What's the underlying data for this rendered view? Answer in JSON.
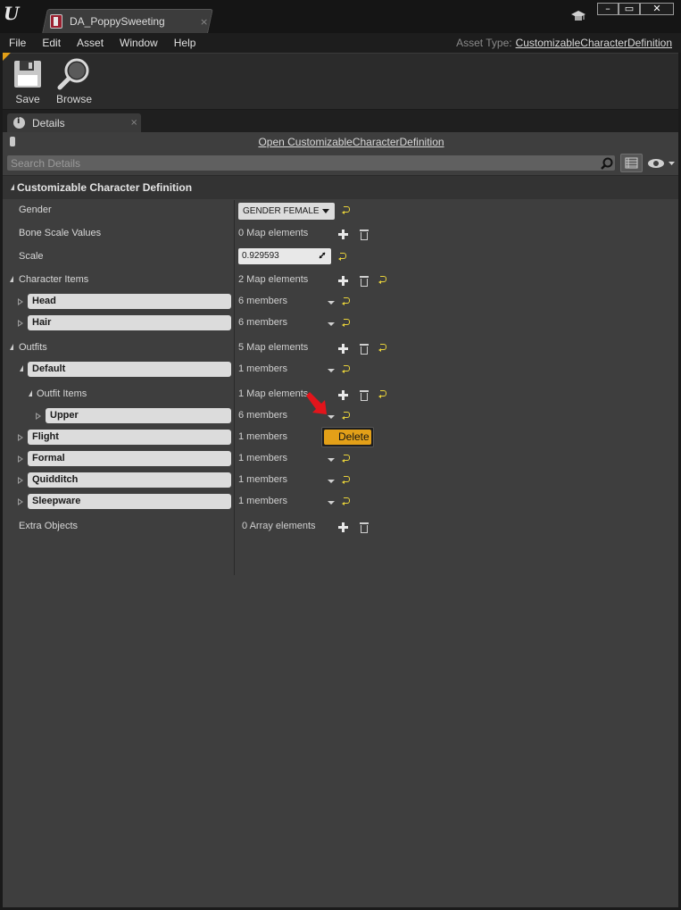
{
  "window": {
    "tab_title": "DA_PoppySweeting",
    "tab_close": "×",
    "min_glyph": "–",
    "max_glyph": "▭",
    "close_glyph": "✕"
  },
  "menu": {
    "items": [
      "File",
      "Edit",
      "Asset",
      "Window",
      "Help"
    ],
    "asset_type_label": "Asset Type:",
    "asset_type_value": "CustomizableCharacterDefinition"
  },
  "toolbar": {
    "save_label": "Save",
    "browse_label": "Browse"
  },
  "details": {
    "tab_label": "Details",
    "tab_close": "×",
    "open_link": "Open CustomizableCharacterDefinition",
    "search_placeholder": "Search Details",
    "category": "Customizable Character Definition"
  },
  "properties": {
    "gender": {
      "name": "Gender",
      "value": "GENDER FEMALE"
    },
    "bone_scale": {
      "name": "Bone Scale Values",
      "value": "0 Map elements"
    },
    "scale": {
      "name": "Scale",
      "value": "0.929593"
    },
    "character_items": {
      "name": "Character Items",
      "value": "2 Map elements"
    },
    "head": {
      "key": "Head",
      "value": "6 members"
    },
    "hair": {
      "key": "Hair",
      "value": "6 members"
    },
    "outfits": {
      "name": "Outfits",
      "value": "5 Map elements"
    },
    "default": {
      "key": "Default",
      "value": "1 members"
    },
    "outfit_items": {
      "name": "Outfit Items",
      "value": "1 Map elements"
    },
    "upper": {
      "key": "Upper",
      "value": "6 members"
    },
    "flight": {
      "key": "Flight",
      "value": "1 members"
    },
    "formal": {
      "key": "Formal",
      "value": "1 members"
    },
    "quidditch": {
      "key": "Quidditch",
      "value": "1 members"
    },
    "sleepware": {
      "key": "Sleepware",
      "value": "1 members"
    },
    "extra_objects": {
      "name": "Extra Objects",
      "value": "0 Array elements"
    }
  },
  "context_menu": {
    "delete_label": "Delete"
  },
  "colors": {
    "accent": "#e3a018",
    "reset_arrow": "#e8d23a",
    "annotation_arrow": "#e3141b"
  },
  "icons": [
    "ue-logo-icon",
    "asset-icon",
    "graduation-cap-icon",
    "save-icon",
    "browse-icon",
    "details-icon",
    "lock-icon",
    "search-icon",
    "list-view-icon",
    "eye-icon",
    "add-icon",
    "trash-icon",
    "reset-to-default-icon",
    "chevron-down-icon",
    "expand-arrow-icon"
  ]
}
